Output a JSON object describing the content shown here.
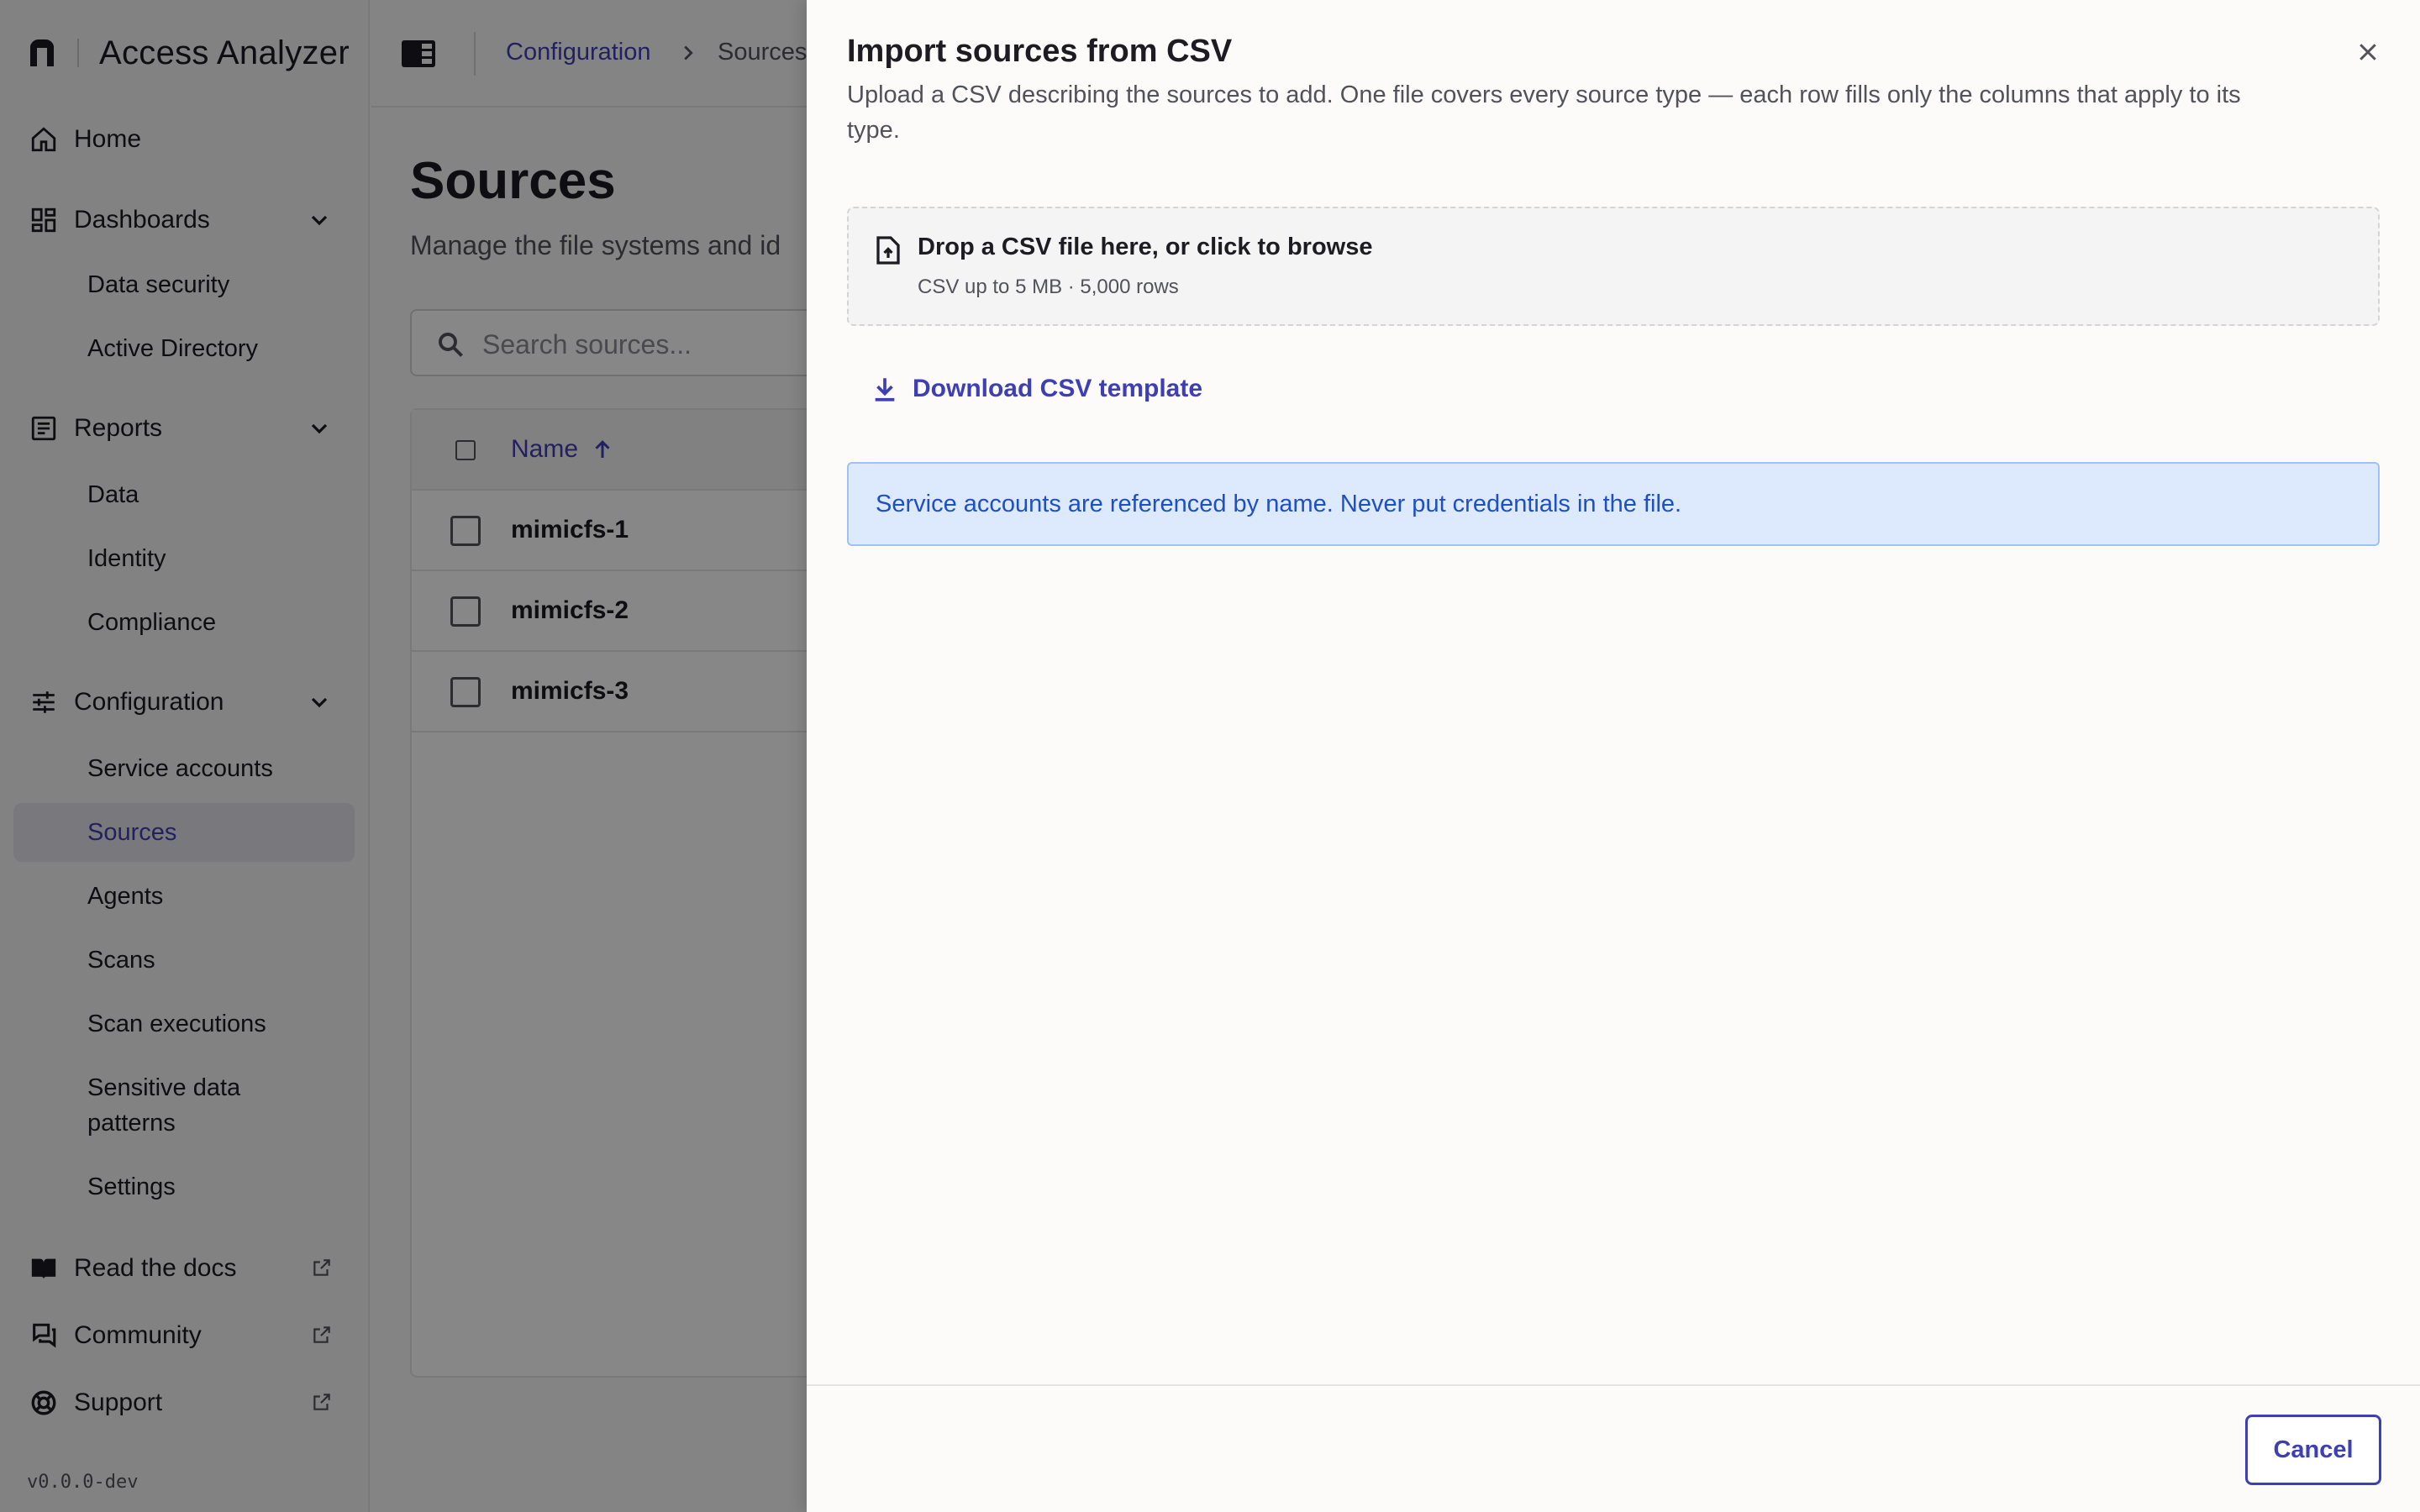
{
  "app": {
    "name": "Access Analyzer",
    "version": "v0.0.0-dev"
  },
  "sidebar": {
    "home": "Home",
    "dashboards": {
      "label": "Dashboards",
      "items": [
        "Data security",
        "Active Directory"
      ]
    },
    "reports": {
      "label": "Reports",
      "items": [
        "Data",
        "Identity",
        "Compliance"
      ]
    },
    "configuration": {
      "label": "Configuration",
      "items": [
        "Service accounts",
        "Sources",
        "Agents",
        "Scans",
        "Scan executions",
        "Sensitive data patterns",
        "Settings"
      ],
      "active": "Sources"
    },
    "links": [
      "Read the docs",
      "Community",
      "Support"
    ]
  },
  "breadcrumb": {
    "parent": "Configuration",
    "current": "Sources"
  },
  "page": {
    "title": "Sources",
    "subtitle": "Manage the file systems and id",
    "search_placeholder": "Search sources..."
  },
  "table": {
    "name_header": "Name",
    "rows": [
      "mimicfs-1",
      "mimicfs-2",
      "mimicfs-3"
    ]
  },
  "drawer": {
    "title": "Import sources from CSV",
    "description": "Upload a CSV describing the sources to add. One file covers every source type — each row fills only the columns that apply to its type.",
    "dropzone_main": "Drop a CSV file here, or click to browse",
    "dropzone_sub": "CSV up to 5 MB · 5,000 rows",
    "download_label": "Download CSV template",
    "callout": "Service accounts are referenced by name. Never put credentials in the file.",
    "cancel_label": "Cancel"
  },
  "colors": {
    "accent": "#3f3fb5",
    "callout_bg": "#ddeafd",
    "callout_text": "#1e4fc4"
  }
}
